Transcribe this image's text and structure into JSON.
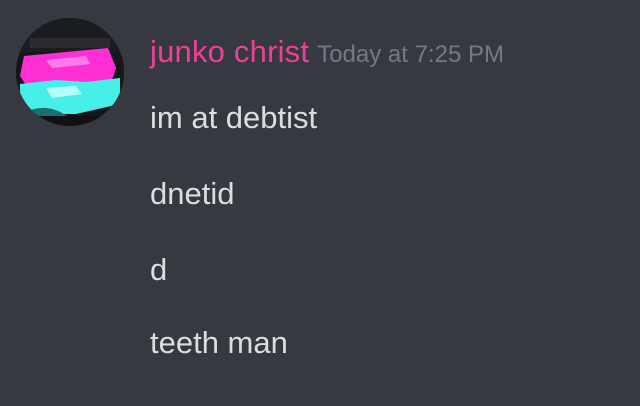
{
  "message": {
    "author": "junko christ",
    "timestamp": "Today at 7:25 PM",
    "lines": [
      "im at debtist",
      "dnetid",
      "d",
      "teeth man"
    ]
  },
  "colors": {
    "background": "#36393f",
    "username": "#ee3f9a",
    "timestamp": "#757980",
    "message_text": "#dcddde",
    "avatar_magenta": "#ff2fd6",
    "avatar_cyan": "#46f0e8"
  },
  "icons": {
    "avatar": "user-avatar"
  }
}
